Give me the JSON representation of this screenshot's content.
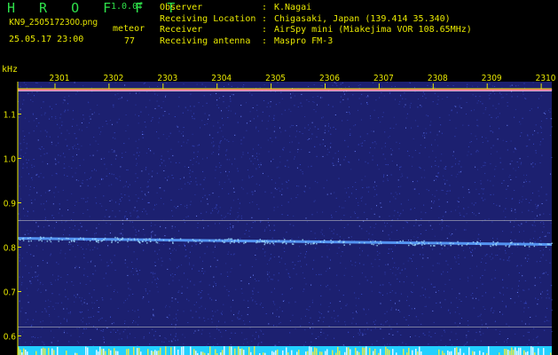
{
  "header": {
    "app_title": "H R O F F T",
    "version": "1.0.0f",
    "filename": "KN9_2505172300.png",
    "meteor_label": "meteor",
    "datetime": "25.05.17 23:00",
    "meteor_count": "77"
  },
  "info": [
    {
      "key": "Observer",
      "value": "K.Nagai"
    },
    {
      "key": "Receiving Location",
      "value": "Chigasaki, Japan (139.414 35.340)"
    },
    {
      "key": "Receiver",
      "value": "AirSpy mini (Miakejima VOR 108.65MHz)"
    },
    {
      "key": "Receiving antenna",
      "value": "Maspro FM-3"
    }
  ],
  "colors": {
    "header_text": "#e8e800",
    "title_green": "#2fe04a",
    "plot_background": "#1c2070",
    "noise_dot": "#3a4fd0",
    "signal_band": "#5aa0ff",
    "grid_line": "#c8c8c8",
    "bottom_band": "#22d0ff"
  },
  "chart_data": {
    "type": "heatmap",
    "xlabel": "",
    "ylabel": "kHz",
    "x_ticks": [
      "2301",
      "2302",
      "2303",
      "2304",
      "2305",
      "2306",
      "2307",
      "2308",
      "2309",
      "2310"
    ],
    "y_ticks": [
      "1.1",
      "1.0",
      "0.9",
      "0.8",
      "0.7",
      "0.6"
    ],
    "ylim": [
      0.6,
      1.16
    ],
    "signals": [
      {
        "freq_start": 1.155,
        "freq_end": 1.155,
        "intensity": "high"
      },
      {
        "freq_start": 0.82,
        "freq_end": 0.806,
        "intensity": "medium"
      },
      {
        "freq_start": 0.86,
        "freq_end": 0.86,
        "intensity": "low"
      },
      {
        "freq_start": 0.62,
        "freq_end": 0.62,
        "intensity": "low"
      }
    ]
  }
}
